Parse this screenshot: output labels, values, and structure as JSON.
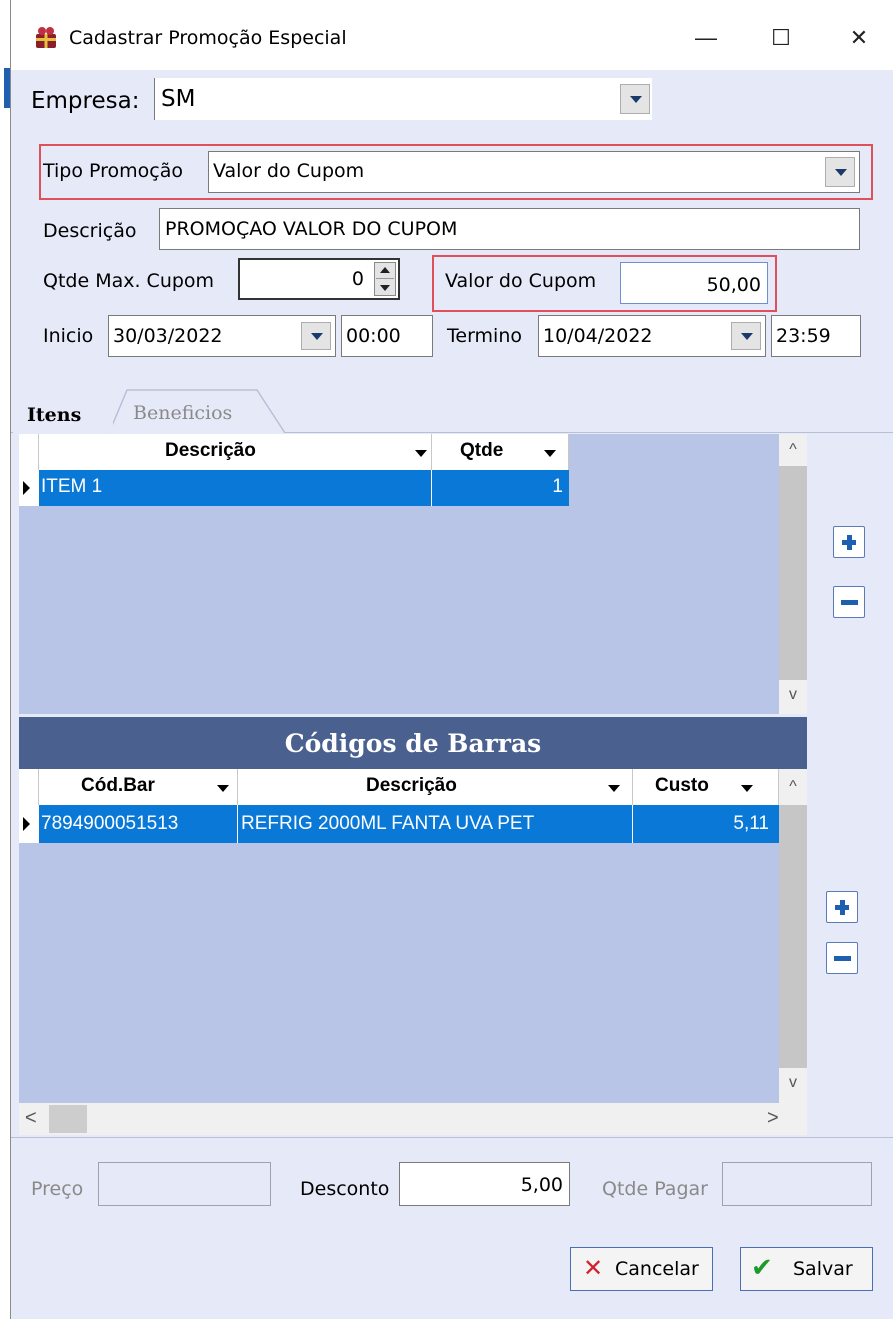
{
  "window": {
    "title": "Cadastrar Promoção Especial",
    "minimize": "—",
    "maximize": "☐",
    "close": "✕"
  },
  "form": {
    "empresa_label": "Empresa:",
    "empresa_value": "SM",
    "tipo_label": "Tipo Promoção",
    "tipo_value": "Valor do Cupom",
    "descricao_label": "Descrição",
    "descricao_value": "PROMOÇAO VALOR DO CUPOM",
    "qtde_label": "Qtde Max. Cupom",
    "qtde_value": "0",
    "valor_label": "Valor do Cupom",
    "valor_value": "50,00",
    "inicio_label": "Inicio",
    "inicio_date": "30/03/2022",
    "inicio_time": "00:00",
    "termino_label": "Termino",
    "termino_date": "10/04/2022",
    "termino_time": "23:59"
  },
  "tabs": [
    {
      "label": "Itens",
      "active": true
    },
    {
      "label": "Beneficios",
      "active": false
    }
  ],
  "items_grid": {
    "columns": [
      "Descrição",
      "Qtde"
    ],
    "rows": [
      {
        "descricao": "ITEM 1",
        "qtde": "1"
      }
    ]
  },
  "barcodes": {
    "title": "Códigos de Barras",
    "columns": [
      "Cód.Bar",
      "Descrição",
      "Custo"
    ],
    "rows": [
      {
        "codbar": "7894900051513",
        "descricao": "REFRIG 2000ML FANTA UVA PET",
        "custo": "5,11"
      }
    ]
  },
  "footer": {
    "preco_label": "Preço",
    "preco_value": "",
    "desconto_label": "Desconto",
    "desconto_value": "5,00",
    "qtde_pagar_label": "Qtde Pagar",
    "qtde_pagar_value": "",
    "cancel_label": "Cancelar",
    "save_label": "Salvar"
  },
  "colors": {
    "selection": "#0a78d7",
    "header_band": "#4a6190",
    "highlight_border": "#e0505a",
    "accent_icon": "#1f5fb0"
  }
}
